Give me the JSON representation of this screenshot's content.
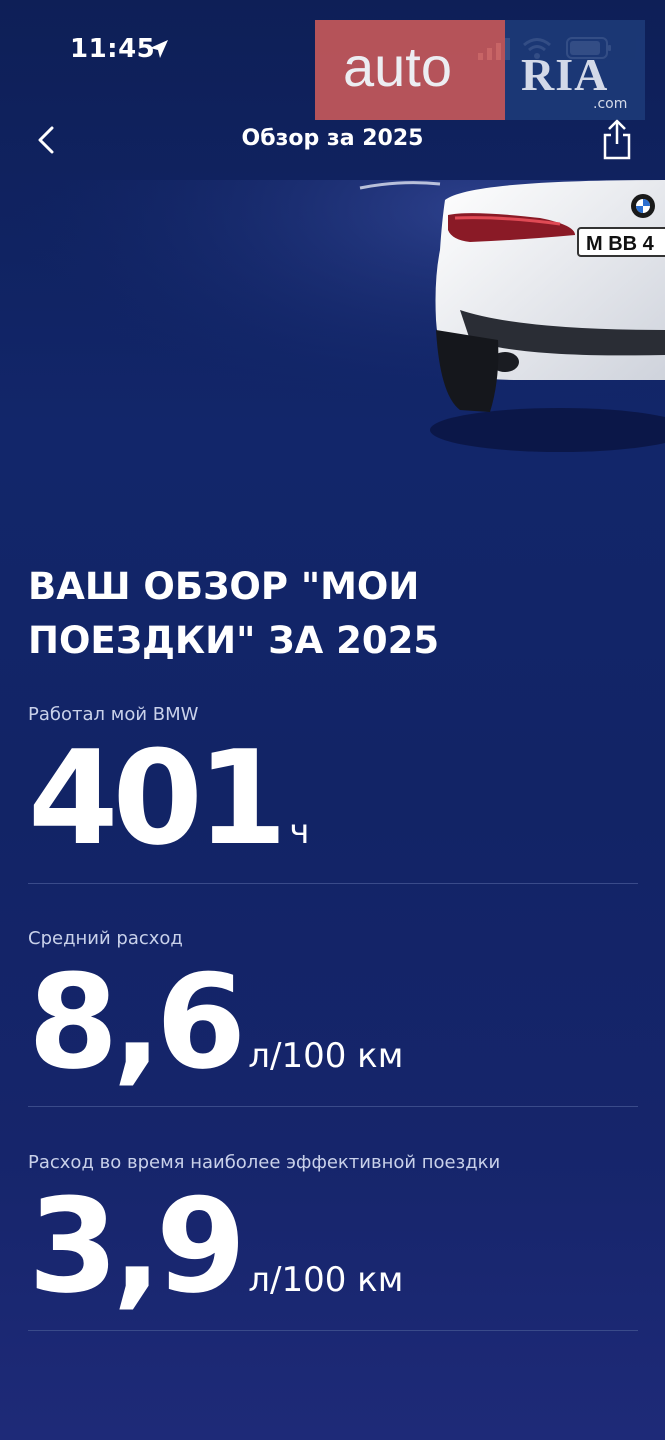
{
  "status_bar": {
    "time": "11:45"
  },
  "watermark": {
    "left_text": "auto",
    "right_text": "RIA",
    "suffix": ".com"
  },
  "nav": {
    "title": "Обзор за 2025"
  },
  "headline": "ВАШ ОБЗОР \"МОИ ПОЕЗДКИ\" ЗА 2025",
  "car": {
    "plate": "M BB 4"
  },
  "stats": [
    {
      "label": "Работал мой BMW",
      "value": "401",
      "unit": "ч"
    },
    {
      "label": "Средний расход",
      "value": "8,6",
      "unit": "л/100 км"
    },
    {
      "label": "Расход во время наиболее эффективной поездки",
      "value": "3,9",
      "unit": "л/100 км"
    }
  ],
  "colors": {
    "background": "#12266a",
    "text": "#ffffff",
    "label": "#c9d1ea",
    "divider": "#3a4b8a"
  }
}
